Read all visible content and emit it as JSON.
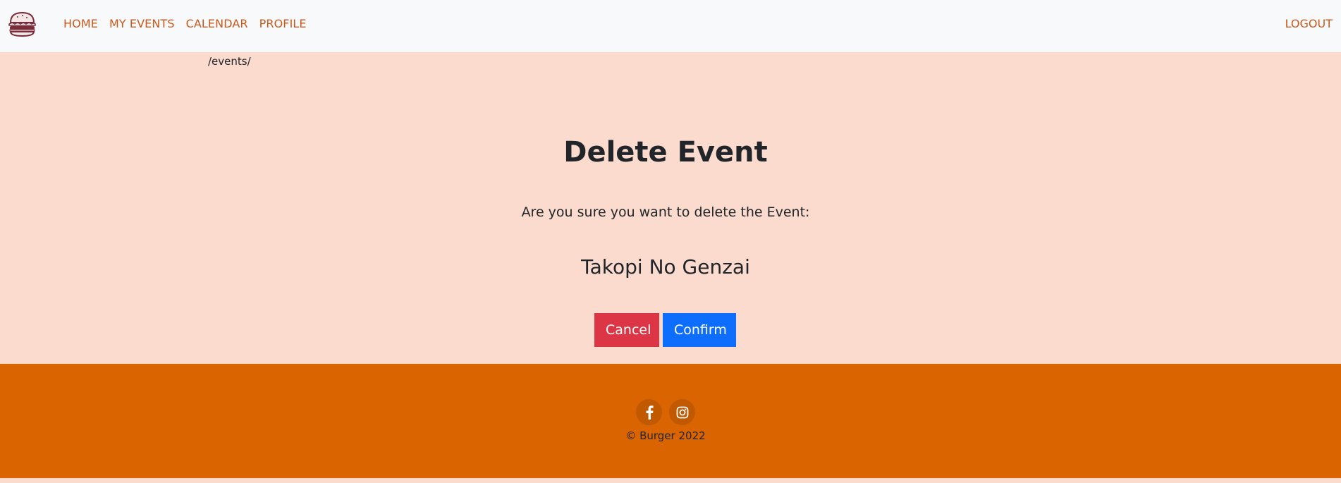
{
  "nav": {
    "items": [
      {
        "label": "HOME"
      },
      {
        "label": "MY EVENTS"
      },
      {
        "label": "CALENDAR"
      },
      {
        "label": "PROFILE"
      }
    ],
    "logout": "LOGOUT",
    "logo_icon": "burger-logo-icon"
  },
  "breadcrumb": "/events/",
  "main": {
    "title": "Delete Event",
    "question": "Are you sure you want to delete the Event:",
    "event_name": "Takopi No Genzai",
    "cancel_label": "Cancel",
    "confirm_label": "Confirm"
  },
  "footer": {
    "social_icons": [
      "facebook-icon",
      "instagram-icon"
    ],
    "copyright": "© Burger 2022"
  },
  "colors": {
    "page_bg": "#fadbce",
    "navbar_bg": "#f8f9fa",
    "nav_link": "#c9581b",
    "cancel": "#dc3545",
    "confirm": "#0d6efd",
    "footer_bg": "#d96400",
    "social_bg": "#c15900"
  }
}
